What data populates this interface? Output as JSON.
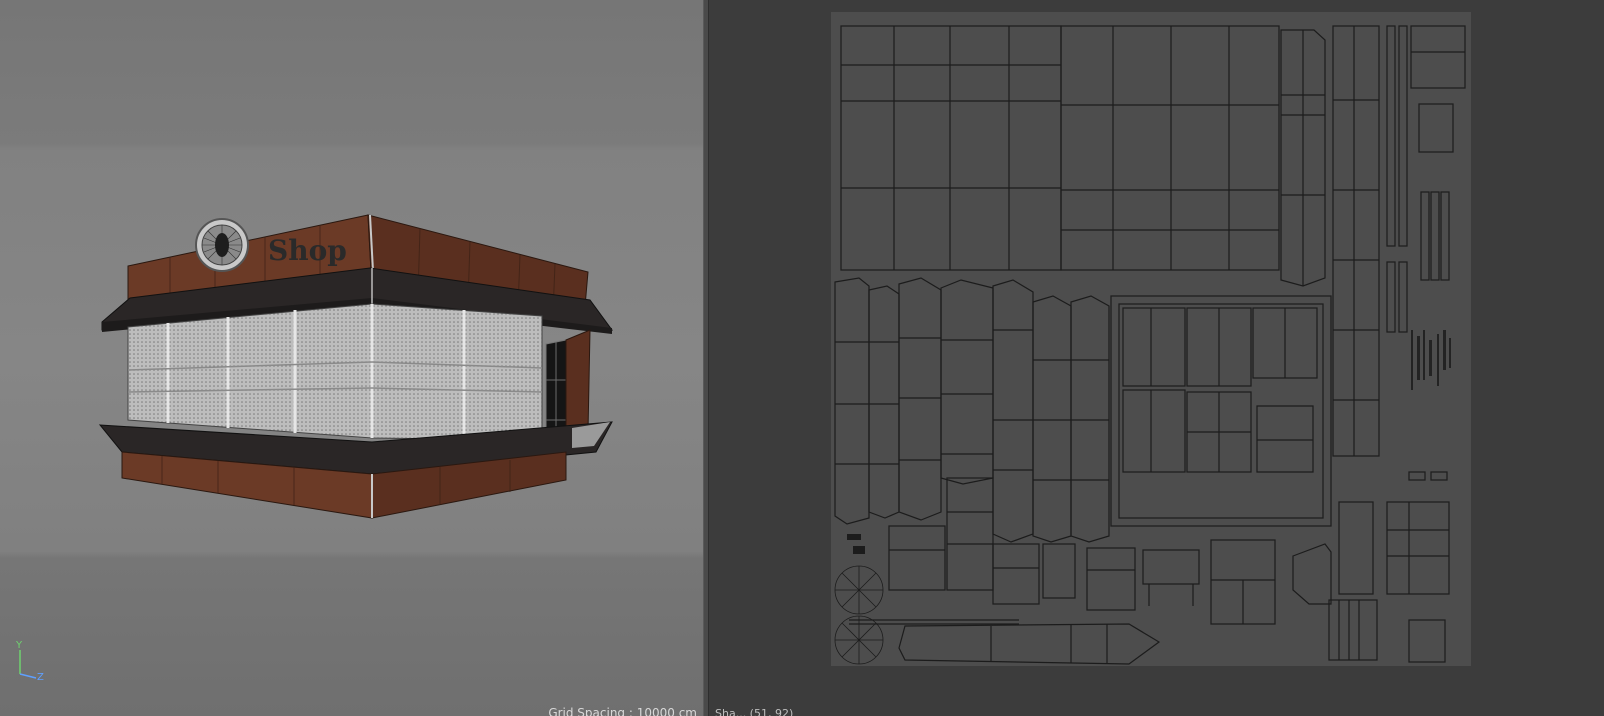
{
  "viewport": {
    "model_sign_text": "Shop",
    "grid_spacing": "Grid Spacing : 10000 cm",
    "axis": {
      "y_label": "Y",
      "z_label": "Z",
      "y_color": "#6fd36f",
      "z_color": "#5fa0ff"
    }
  },
  "uv_editor": {
    "status_text": "Sha... (51, 92)",
    "uv_line_color": "#1c1c1c",
    "uv_fill_color": "#4d4d4d"
  }
}
